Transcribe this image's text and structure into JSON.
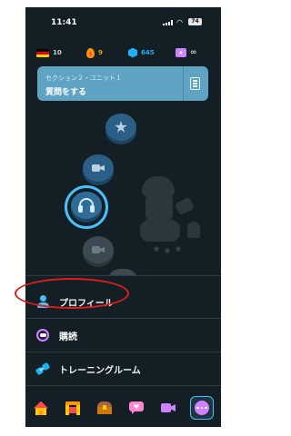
{
  "status_bar": {
    "time": "11:41",
    "battery": "74"
  },
  "stats": {
    "language_flag": "germany-flag-icon",
    "language_count": "10",
    "streak": "9",
    "gems": "645",
    "energy": "∞"
  },
  "unit_banner": {
    "subtitle": "セクション２・ユニット１",
    "title": "質問をする"
  },
  "menu": {
    "items": [
      {
        "label": "プロフィール",
        "icon": "person-icon"
      },
      {
        "label": "購読",
        "icon": "subscription-icon"
      },
      {
        "label": "トレーニングルーム",
        "icon": "dumbbell-icon"
      }
    ]
  },
  "tabs": [
    "home-icon",
    "leaderboard-gate-icon",
    "chest-icon",
    "chat-heart-icon",
    "video-icon",
    "more-icon"
  ],
  "colors": {
    "background": "#131f24",
    "banner": "#5fa3c3",
    "accent_blue": "#49c0f8",
    "annotation_red": "#e31b1b"
  }
}
